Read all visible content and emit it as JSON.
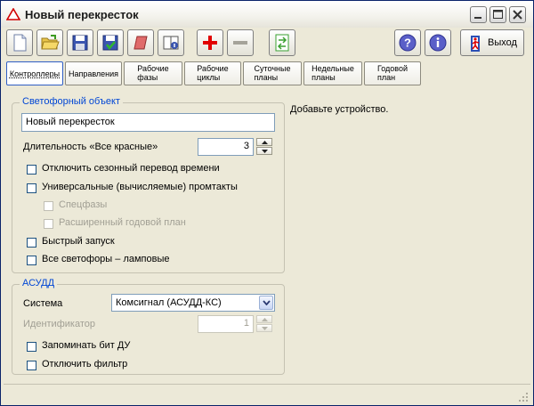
{
  "window": {
    "title": "Новый перекресток"
  },
  "toolbar": {
    "exit_label": "Выход"
  },
  "tabs": [
    {
      "line1": "Контроллеры",
      "line2": "",
      "accel": "К"
    },
    {
      "line1": "Направления",
      "line2": "",
      "accel": "Н"
    },
    {
      "line1": "Рабочие",
      "line2": "фазы",
      "accel": ""
    },
    {
      "line1": "Рабочие",
      "line2": "циклы",
      "accel": ""
    },
    {
      "line1": "Суточные",
      "line2": "планы",
      "accel": "С"
    },
    {
      "line1": "Недельные",
      "line2": "планы",
      "accel": "д"
    },
    {
      "line1": "Годовой",
      "line2": "план",
      "accel": "Г"
    }
  ],
  "svetofor": {
    "legend": "Светофорный объект",
    "name_value": "Новый перекресток",
    "all_red_label": "Длительность «Все красные»",
    "all_red_value": "3",
    "checks": [
      {
        "label": "Отключить сезонный перевод времени",
        "disabled": false
      },
      {
        "label": "Универсальные (вычисляемые) промтакты",
        "disabled": false
      },
      {
        "label": "Спецфазы",
        "disabled": true
      },
      {
        "label": "Расширенный годовой план",
        "disabled": true
      },
      {
        "label": "Быстрый запуск",
        "disabled": false
      },
      {
        "label": "Все светофоры – ламповые",
        "disabled": false
      }
    ]
  },
  "asudd": {
    "legend": "АСУДД",
    "system_label": "Система",
    "system_value": "Комсигнал (АСУДД-КС)",
    "id_label": "Идентификатор",
    "id_value": "1",
    "checks": [
      {
        "label": "Запоминать бит ДУ"
      },
      {
        "label": "Отключить фильтр"
      }
    ]
  },
  "right_message": "Добавьте устройство.",
  "colors": {
    "accent_blue": "#0046d5",
    "window_bg": "#ece9d8"
  }
}
